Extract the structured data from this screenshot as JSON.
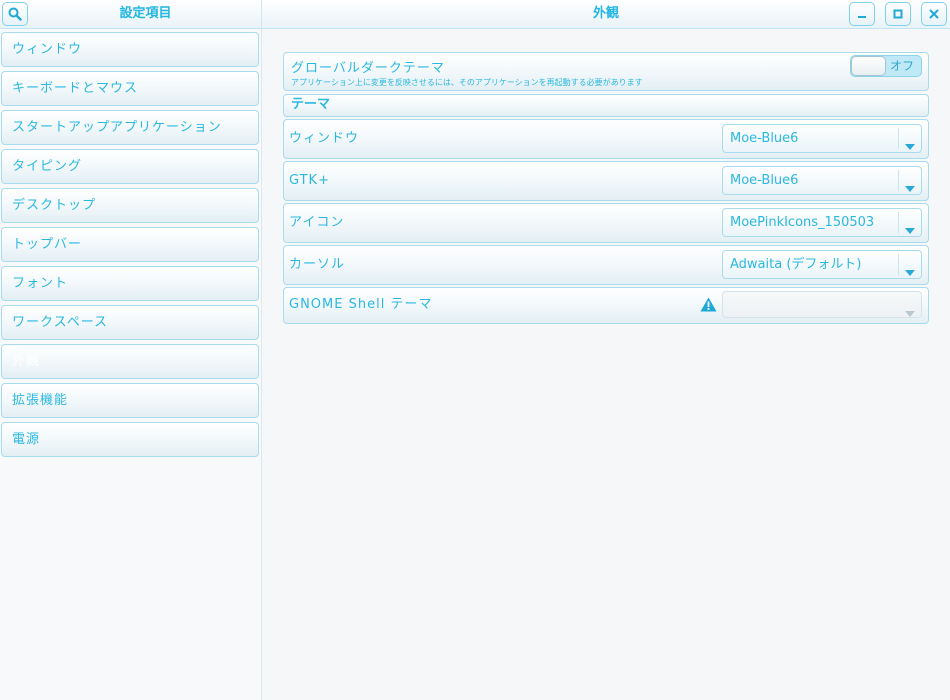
{
  "window": {
    "sidebar_title": "設定項目",
    "page_title": "外観"
  },
  "sidebar": {
    "items": [
      {
        "label": "ウィンドウ"
      },
      {
        "label": "キーボードとマウス"
      },
      {
        "label": "スタートアップアプリケーション"
      },
      {
        "label": "タイピング"
      },
      {
        "label": "デスクトップ"
      },
      {
        "label": "トップバー"
      },
      {
        "label": "フォント"
      },
      {
        "label": "ワークスペース"
      },
      {
        "label": "外観",
        "selected": true
      },
      {
        "label": "拡張機能"
      },
      {
        "label": "電源"
      }
    ]
  },
  "main": {
    "dark_theme": {
      "label": "グローバルダークテーマ",
      "note": "アプリケーション上に変更を反映させるには、そのアプリケーションを再起動する必要があります",
      "switch_label": "オフ",
      "switch_on": false
    },
    "section_header": "テーマ",
    "rows": [
      {
        "label": "ウィンドウ",
        "value": "Moe-Blue6"
      },
      {
        "label": "GTK+",
        "value": "Moe-Blue6"
      },
      {
        "label": "アイコン",
        "value": "MoePinkIcons_150503"
      },
      {
        "label": "カーソル",
        "value": "Adwaita (デフォルト)"
      }
    ],
    "shell_row": {
      "label": "GNOME Shell テーマ",
      "value": "",
      "warning_icon": "warning-icon",
      "disabled": true
    }
  },
  "colors": {
    "accent": "#2bb8e0",
    "border": "#a8dcec",
    "background": "#f5f7f8",
    "warning": "#1fa8d8"
  }
}
